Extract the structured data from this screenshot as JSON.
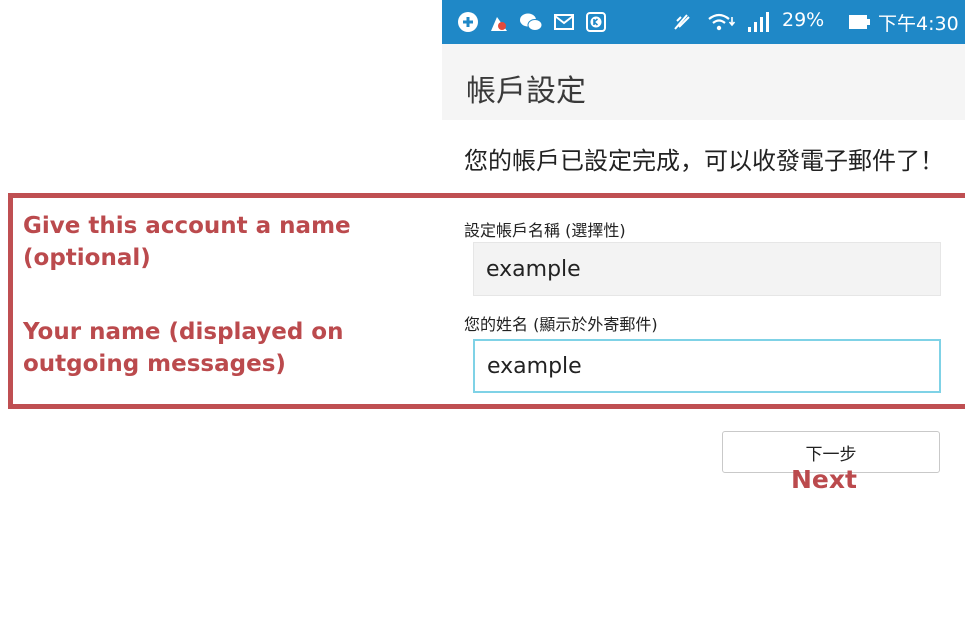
{
  "status_bar": {
    "notification_icons": [
      "plus-badge-icon",
      "cleaner-icon",
      "wechat-icon",
      "mail-icon",
      "k-app-icon"
    ],
    "battery_percent": "29%",
    "time": "下午4:30",
    "color": "#1f88c7"
  },
  "app": {
    "title": "帳戶設定"
  },
  "content": {
    "done_message": "您的帳戶已設定完成，可以收發電子郵件了！",
    "account_name_label": "設定帳戶名稱 (選擇性)",
    "account_name_value": "example",
    "your_name_label": "您的姓名 (顯示於外寄郵件)",
    "your_name_value": "example",
    "next_label": "下一步"
  },
  "annotations": {
    "account_name": "Give this account a name (optional)",
    "your_name": "Your name (displayed on outgoing messages)",
    "next": "Next",
    "color": "#bb4a4d"
  }
}
